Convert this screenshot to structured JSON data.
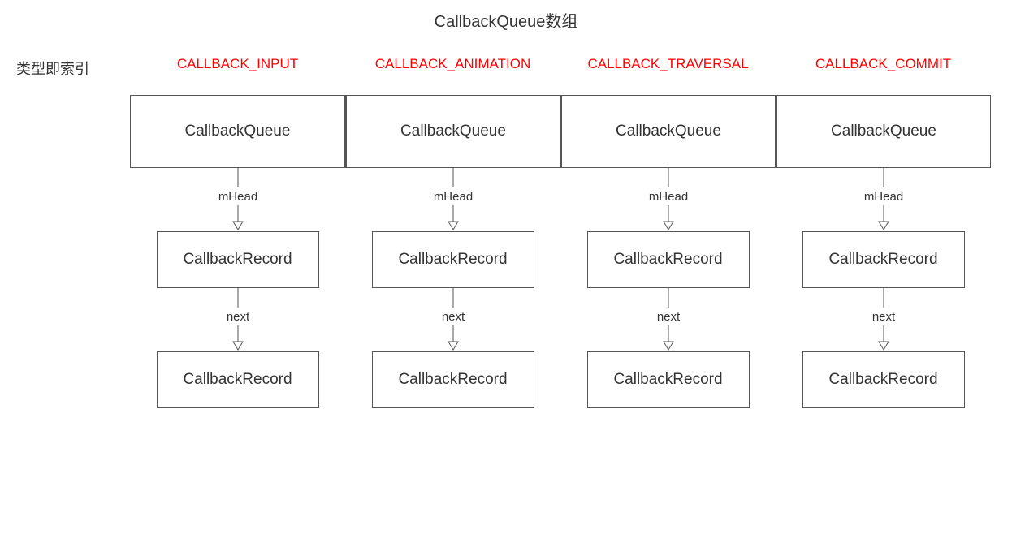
{
  "title": "CallbackQueue数组",
  "side_label": "类型即索引",
  "columns": [
    {
      "type": "CALLBACK_INPUT",
      "queue": "CallbackQueue",
      "head_label": "mHead",
      "record1": "CallbackRecord",
      "next_label": "next",
      "record2": "CallbackRecord"
    },
    {
      "type": "CALLBACK_ANIMATION",
      "queue": "CallbackQueue",
      "head_label": "mHead",
      "record1": "CallbackRecord",
      "next_label": "next",
      "record2": "CallbackRecord"
    },
    {
      "type": "CALLBACK_TRAVERSAL",
      "queue": "CallbackQueue",
      "head_label": "mHead",
      "record1": "CallbackRecord",
      "next_label": "next",
      "record2": "CallbackRecord"
    },
    {
      "type": "CALLBACK_COMMIT",
      "queue": "CallbackQueue",
      "head_label": "mHead",
      "record1": "CallbackRecord",
      "next_label": "next",
      "record2": "CallbackRecord"
    }
  ]
}
